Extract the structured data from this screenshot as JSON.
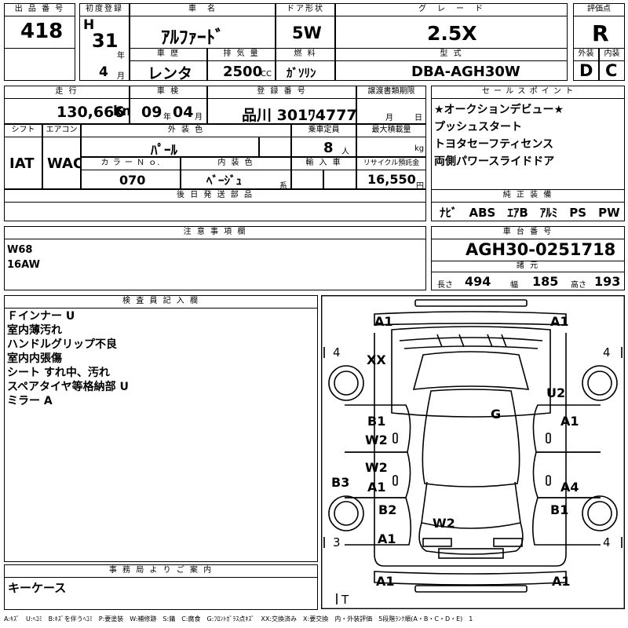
{
  "header": {
    "lot_label": "出 品 番 号",
    "lot_no": "418",
    "first_reg_label": "初度登録",
    "era": "H",
    "year": "31",
    "year_unit": "年",
    "month": "4",
    "month_unit": "月",
    "name_label": "車　名",
    "name": "ｱﾙﾌｧｰﾄﾞ",
    "door_label": "ドア形状",
    "door": "5W",
    "grade_label": "グ　レ　ー　ド",
    "grade": "2.5X",
    "score_label": "評価点",
    "score": "R",
    "history_label": "車 歴",
    "history": "レンタ",
    "displacement_label": "排 気 量",
    "displacement": "2500",
    "displacement_unit": "CC",
    "fuel_label": "燃 料",
    "fuel": "ｶﾞｿﾘﾝ",
    "model_label": "型 式",
    "model": "DBA-AGH30W",
    "ext_label": "外装",
    "ext": "D",
    "int_label": "内装",
    "int": "C"
  },
  "second": {
    "mileage_label": "走 行",
    "mileage": "130,666",
    "mileage_unit": "km",
    "inspection_label": "車 検",
    "insp_year": "09",
    "insp_year_unit": "年",
    "insp_month": "04",
    "insp_month_unit": "月",
    "reg_label": "登 録 番 号",
    "reg": "品川 301ﾜ4777",
    "transfer_label": "譲渡書類期限",
    "transfer_month_unit": "月",
    "transfer_day_unit": "日",
    "shift_label": "シフト",
    "shift": "IAT",
    "ac_label": "エアコン",
    "ac": "WAC",
    "color_label": "外 装 色",
    "color": "ﾊﾟｰﾙ",
    "capacity_label": "乗車定員",
    "capacity": "8",
    "capacity_unit": "人",
    "load_label": "最大積載量",
    "load_unit": "kg",
    "colorno_label": "カ ラ ー Ｎ ｏ.",
    "colorno": "070",
    "interior_label": "内 装 色",
    "interior": "ﾍﾞｰｼﾞｭ",
    "interior_unit": "系",
    "import_label": "輸 入 車",
    "recycle_label": "リサイクル預託金",
    "recycle": "16,550",
    "recycle_unit": "円",
    "later_label": "後 日 発 送 部 品"
  },
  "sales": {
    "label": "セ ー ル ス ポ イ ン ト",
    "points": [
      "★オークションデビュー★",
      "プッシュスタート",
      "トヨタセーフティセンス",
      "両側パワースライドドア"
    ]
  },
  "equipment": {
    "label": "純 正 装 備",
    "items": "ﾅﾋﾞ　ABS　ｴｱB　ｱﾙﾐ　PS　PW"
  },
  "notes": {
    "label": "注 意 事 項 欄",
    "lines": [
      "W68",
      "16AW"
    ]
  },
  "chassis": {
    "label": "車 台 番 号",
    "number": "AGH30-0251718",
    "dims_label": "諸 元",
    "length_label": "長さ",
    "length": "494",
    "width_label": "幅",
    "width": "185",
    "height_label": "高さ",
    "height": "193"
  },
  "inspector": {
    "label": "検 査 員 記 入 欄",
    "lines": [
      "Ｆインナー U",
      "室内薄汚れ",
      "ハンドルグリップ不良",
      "室内内張傷",
      "シート すれ中、汚れ",
      "スペアタイヤ等格納部 U",
      "ミラー A"
    ]
  },
  "office": {
    "label": "事 務 局 よ り ご 案 内",
    "text": "キーケース"
  },
  "legend": "A:ｷｽﾞ　U:ﾍｺﾐ　B:ｷｽﾞを伴うﾍｺﾐ　P:要塗装　W:補修跡　S:錆　C:腐食　G:ﾌﾛﾝﾄｶﾞﾗｽ点ｷｽﾞ　XX:交換済み　X:要交換　内・外装評価　5段階ﾗﾝｸ順(A・B・C・D・E)　1",
  "diagram": {
    "tl_front": "A1",
    "tr_front": "A1",
    "tire_fl": "4",
    "tire_fr": "4",
    "tire_rl": "3",
    "tire_rr": "4",
    "trunk": "T",
    "xx": "XX",
    "u2": "U2",
    "g": "G",
    "l_door1": "B1",
    "l_door1b": "W2",
    "l_door2": "W2",
    "l_door2b": "A1",
    "r_door1": "A1",
    "r_door2": "A4",
    "l_side": "B3",
    "l_rear": "B2",
    "l_rear2": "A1",
    "r_rear": "B1",
    "w2_rear": "W2",
    "bl": "A1",
    "br": "A1"
  }
}
